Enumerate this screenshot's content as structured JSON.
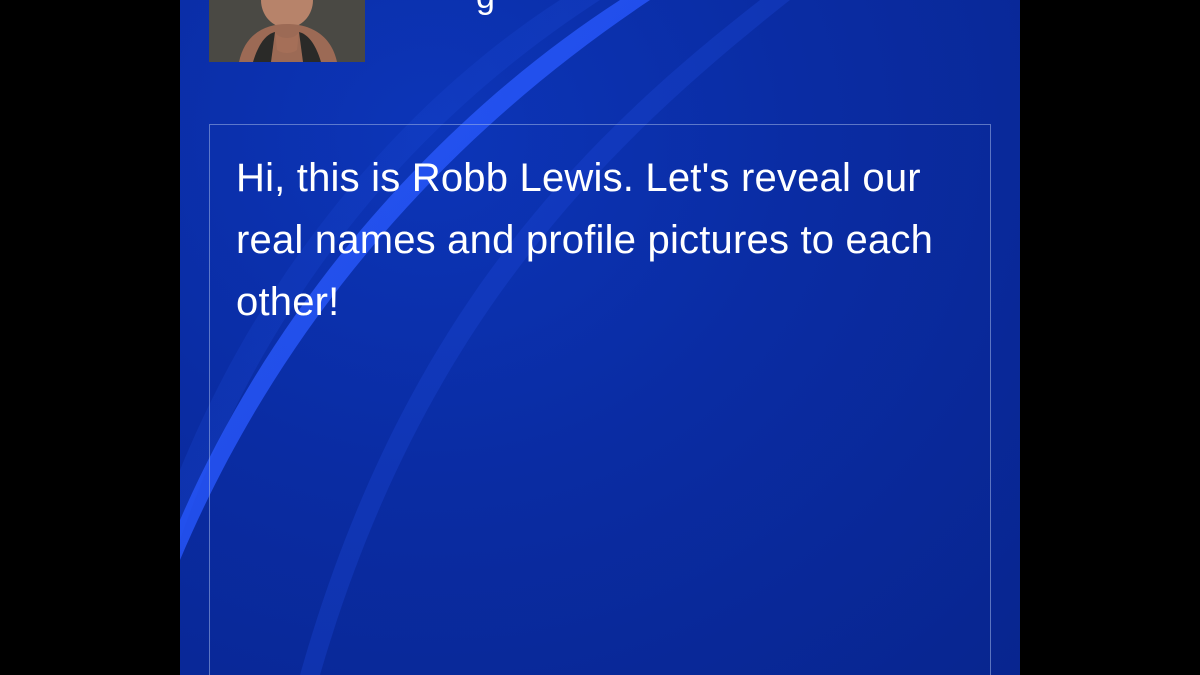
{
  "sender": {
    "avatar_icon": "user-avatar-photo",
    "name_fragment": "g"
  },
  "message": {
    "text": "Hi, this is Robb Lewis. Let's reveal our real names and profile pictures to each other!"
  },
  "colors": {
    "background": "#0a2ca3",
    "letterbox": "#000000",
    "text": "#ffffff",
    "accent_swoosh": "#1a4dff"
  }
}
